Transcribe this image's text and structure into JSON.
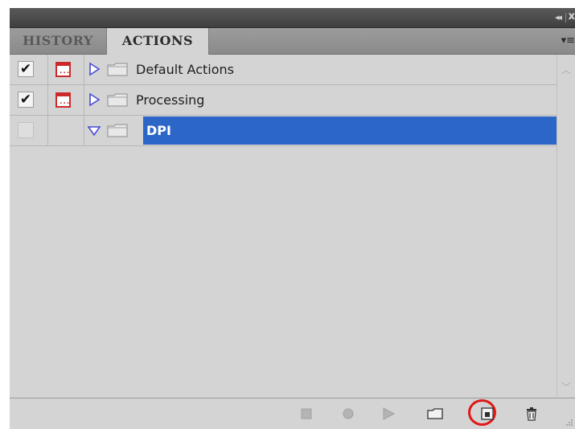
{
  "panel": {
    "collapse_glyph": "◂◂",
    "close_glyph": "x",
    "menu_glyph": "▾≡"
  },
  "tabs": [
    {
      "label": "HISTORY",
      "active": false
    },
    {
      "label": "ACTIONS",
      "active": true
    }
  ],
  "action_sets": [
    {
      "label": "Default Actions",
      "checked": true,
      "dialog_toggle": true,
      "expanded": false,
      "selected": false
    },
    {
      "label": "Processing",
      "checked": true,
      "dialog_toggle": true,
      "expanded": false,
      "selected": false
    },
    {
      "label": "DPI",
      "checked": false,
      "dialog_toggle": false,
      "expanded": true,
      "selected": true
    }
  ],
  "icons": {
    "check": "✔",
    "dialog": "...",
    "scroll_up": "︿",
    "scroll_down": "﹀"
  },
  "toolbar": {
    "buttons": [
      "stop-playing-icon",
      "begin-recording-icon",
      "play-selection-icon",
      "create-new-set-icon",
      "create-new-action-icon",
      "delete-icon"
    ],
    "highlighted": "create-new-action-icon"
  },
  "colors": {
    "selection": "#2c67c7",
    "highlight_ring": "#e01818",
    "dialog_icon": "#cc2a2a",
    "expander": "#4a4ad8"
  }
}
